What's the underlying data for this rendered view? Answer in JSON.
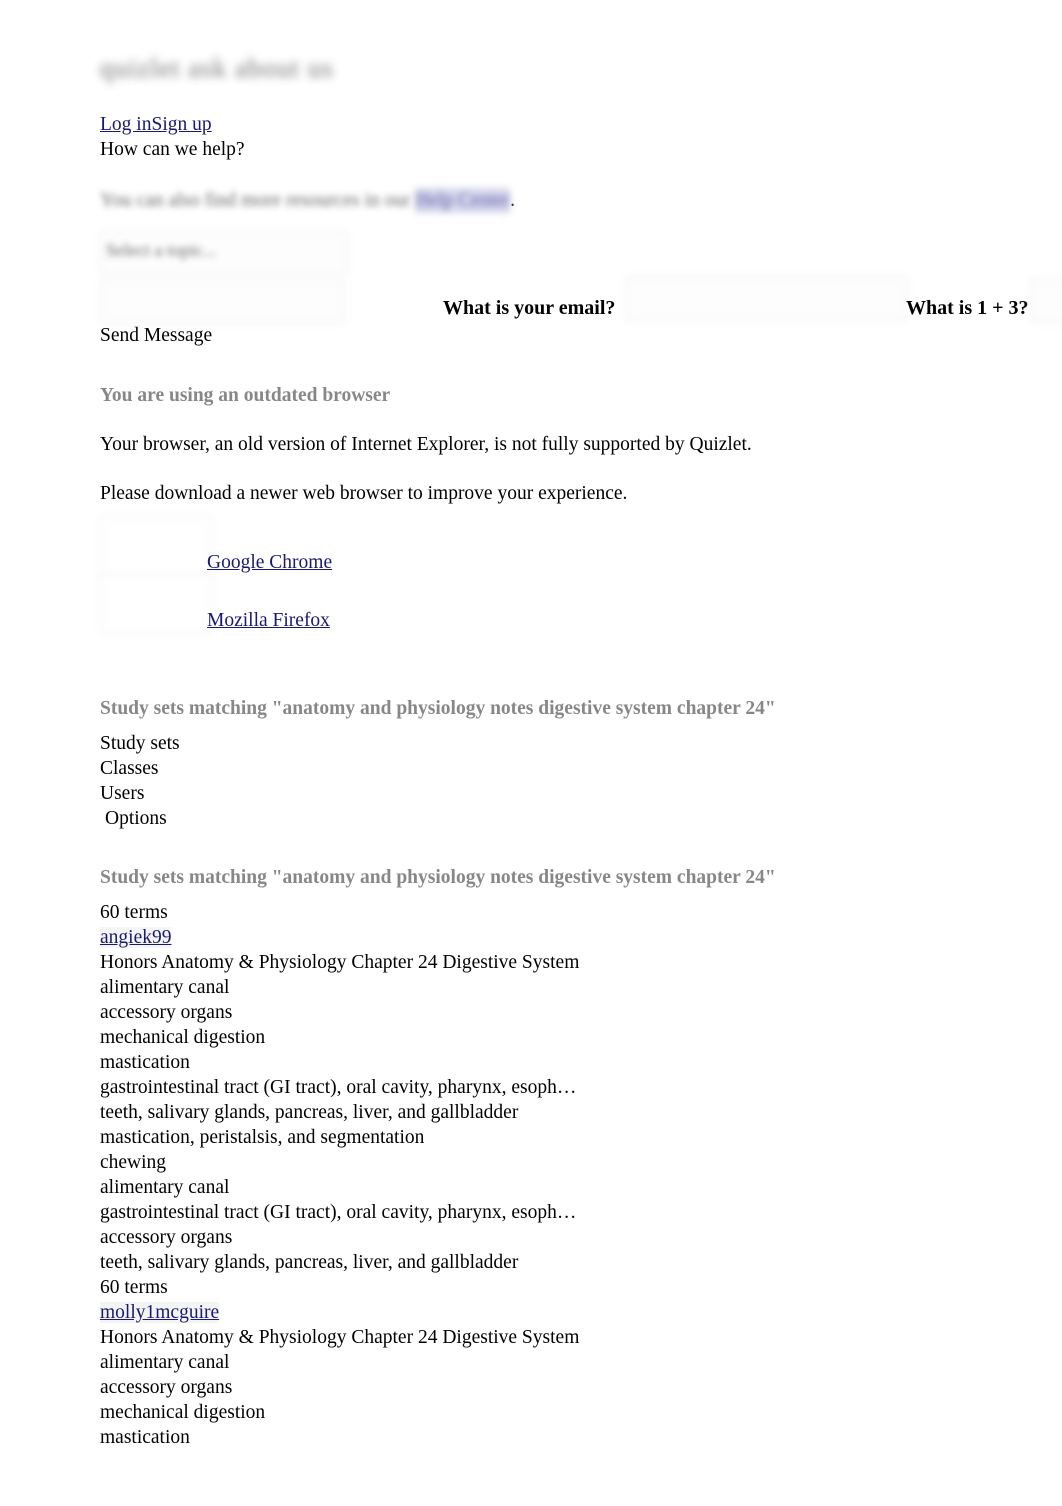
{
  "header": {
    "logo_text_obscured": "quizlet ask about us",
    "auth_links": [
      {
        "label": "Log in"
      },
      {
        "label": "Sign up"
      }
    ],
    "tagline": "How can we help?"
  },
  "help_notice": {
    "text_obscured": "You can also find more resources in our",
    "link_obscured": "Help Center",
    "trailing": "."
  },
  "contact_form": {
    "topic_select_value_obscured": "Select a topic...",
    "message_input_value": "",
    "email_label": "What is your email?",
    "email_input_value": "",
    "math_label": "What is 1 + 3?",
    "math_input_value": "",
    "submit_label": "Send Message"
  },
  "browser_warning": {
    "heading": "You are using an outdated browser",
    "line1": "Your browser, an old version of Internet Explorer, is not fully supported by Quizlet.",
    "line2": "Please download a newer web browser to improve your experience.",
    "downloads": [
      {
        "label": "Google Chrome",
        "icon": "chrome-logo-image"
      },
      {
        "label": "Mozilla Firefox",
        "icon": "firefox-logo-image"
      }
    ]
  },
  "search_results_nav": {
    "heading": "Study sets matching \"anatomy and physiology notes digestive system chapter 24\"",
    "tabs": [
      {
        "label": "Study sets"
      },
      {
        "label": "Classes"
      },
      {
        "label": "Users"
      }
    ],
    "options_label": "Options"
  },
  "search_results": {
    "heading": "Study sets matching \"anatomy and physiology notes digestive system chapter 24\"",
    "sets": [
      {
        "term_count": "60 terms",
        "author": "angiek99",
        "title": "Honors Anatomy & Physiology Chapter 24 Digestive System",
        "preview_lines": [
          "alimentary canal",
          "accessory organs",
          "mechanical digestion",
          "mastication",
          "gastrointestinal tract (GI tract), oral cavity, pharynx, esoph…",
          "teeth, salivary glands, pancreas, liver, and gallbladder",
          "mastication, peristalsis, and segmentation",
          "chewing",
          "alimentary canal",
          "gastrointestinal tract (GI tract), oral cavity, pharynx, esoph…",
          "accessory organs",
          "teeth, salivary glands, pancreas, liver, and gallbladder"
        ]
      },
      {
        "term_count": "60 terms",
        "author": "molly1mcguire",
        "title": "Honors Anatomy & Physiology Chapter 24 Digestive System",
        "preview_lines": [
          "alimentary canal",
          "accessory organs",
          "mechanical digestion",
          "mastication"
        ]
      }
    ]
  },
  "colors": {
    "link": "#191970",
    "gray_heading": "#878787",
    "text": "#000000",
    "background": "#ffffff",
    "obscured_link": "#5b5ba8"
  }
}
